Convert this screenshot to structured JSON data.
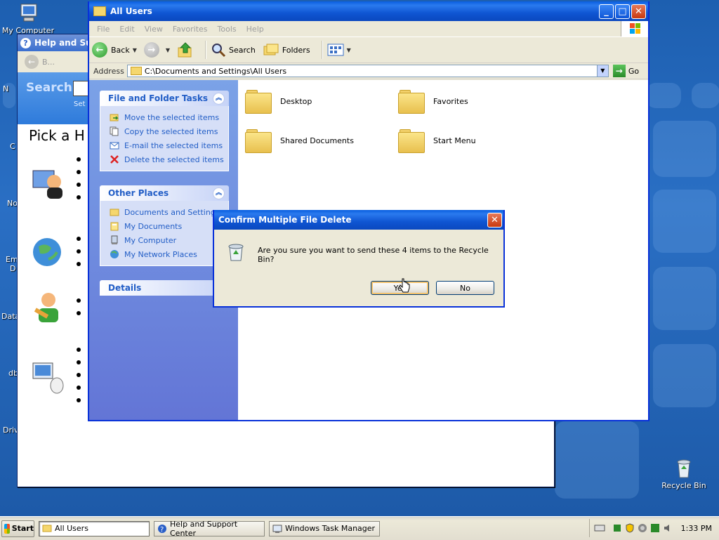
{
  "desktop": {
    "icons": [
      {
        "label": "My Computer"
      },
      {
        "label": "Recycle Bin"
      }
    ],
    "edge_labels": [
      "N",
      "C",
      "No",
      "Em",
      "D",
      "Data",
      "db",
      "Driv"
    ]
  },
  "help_window": {
    "title": "Help and Supp",
    "back_label": "B...",
    "search_label": "Search",
    "set_label": "Set s",
    "heading": "Pick a H"
  },
  "explorer": {
    "title": "All Users",
    "menu": [
      "File",
      "Edit",
      "View",
      "Favorites",
      "Tools",
      "Help"
    ],
    "toolbar": {
      "back": "Back",
      "search": "Search",
      "folders": "Folders"
    },
    "address": {
      "label": "Address",
      "value": "C:\\Documents and Settings\\All Users",
      "go": "Go"
    },
    "file_tasks": {
      "title": "File and Folder Tasks",
      "items": [
        "Move the selected items",
        "Copy the selected items",
        "E-mail the selected items",
        "Delete the selected items"
      ]
    },
    "other_places": {
      "title": "Other Places",
      "items": [
        "Documents and Settings",
        "My Documents",
        "My Computer",
        "My Network Places"
      ]
    },
    "details": {
      "title": "Details"
    },
    "folders": [
      {
        "name": "Desktop"
      },
      {
        "name": "Favorites"
      },
      {
        "name": "Shared Documents"
      },
      {
        "name": "Start Menu"
      }
    ]
  },
  "dialog": {
    "title": "Confirm Multiple File Delete",
    "message": "Are you sure you want to send these 4 items to the Recycle Bin?",
    "yes": "Yes",
    "no": "No"
  },
  "taskbar": {
    "start": "Start",
    "tasks": [
      {
        "label": "All Users",
        "active": true
      },
      {
        "label": "Help and Support Center",
        "active": false
      },
      {
        "label": "Windows Task Manager",
        "active": false
      }
    ],
    "clock": "1:33 PM"
  }
}
